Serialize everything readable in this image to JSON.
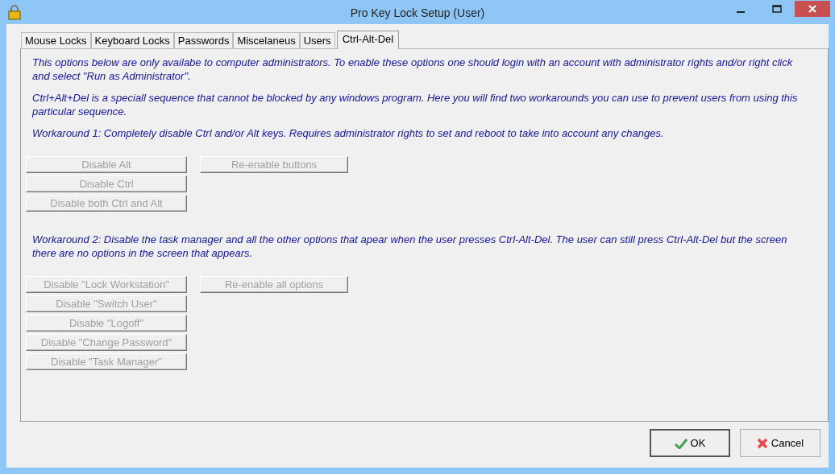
{
  "window": {
    "title": "Pro Key Lock Setup (User)"
  },
  "tabs": [
    {
      "label": "Mouse Locks",
      "selected": false
    },
    {
      "label": "Keyboard Locks",
      "selected": false
    },
    {
      "label": "Passwords",
      "selected": false
    },
    {
      "label": "Miscelaneus",
      "selected": false
    },
    {
      "label": "Users",
      "selected": false
    },
    {
      "label": "Ctrl-Alt-Del",
      "selected": true
    }
  ],
  "intro": [
    "This options below are only availabe to computer administrators. To enable these options one should login with an account with administrator rights and/or right click and select \"Run as Administrator\".",
    "Ctrl+Alt+Del is a speciall sequence that cannot be blocked by any windows program. Here you will find two workarounds you can use to prevent users from using this particular sequence."
  ],
  "workarounds": [
    {
      "text": "Workaround 1: Completely disable Ctrl and/or Alt keys. Requires administrator rights to set and reboot to take into account any changes.",
      "buttons": [
        {
          "label": "Disable Alt",
          "disabled": true
        },
        {
          "label": "Disable Ctrl",
          "disabled": true
        },
        {
          "label": "Disable both Ctrl and Alt",
          "disabled": true
        }
      ],
      "reset": {
        "label": "Re-enable buttons",
        "disabled": true
      }
    },
    {
      "text": "Workaround 2: Disable the task manager and all the other options that apear when the user presses Ctrl-Alt-Del. The user can still press Ctrl-Alt-Del but the screen there are no options in the screen that appears.",
      "buttons": [
        {
          "label": "Disable \"Lock Workstation\"",
          "disabled": true
        },
        {
          "label": "Disable \"Switch User\"",
          "disabled": true
        },
        {
          "label": "Disable \"Logoff\"",
          "disabled": true
        },
        {
          "label": "Disable \"Change Password\"",
          "disabled": true
        },
        {
          "label": "Disable \"Task Manager\"",
          "disabled": true
        }
      ],
      "reset": {
        "label": "Re-enable all options",
        "disabled": true
      }
    }
  ],
  "footer_buttons": [
    {
      "label": "OK",
      "kind": "ok"
    },
    {
      "label": "Cancel",
      "kind": "cancel"
    }
  ]
}
